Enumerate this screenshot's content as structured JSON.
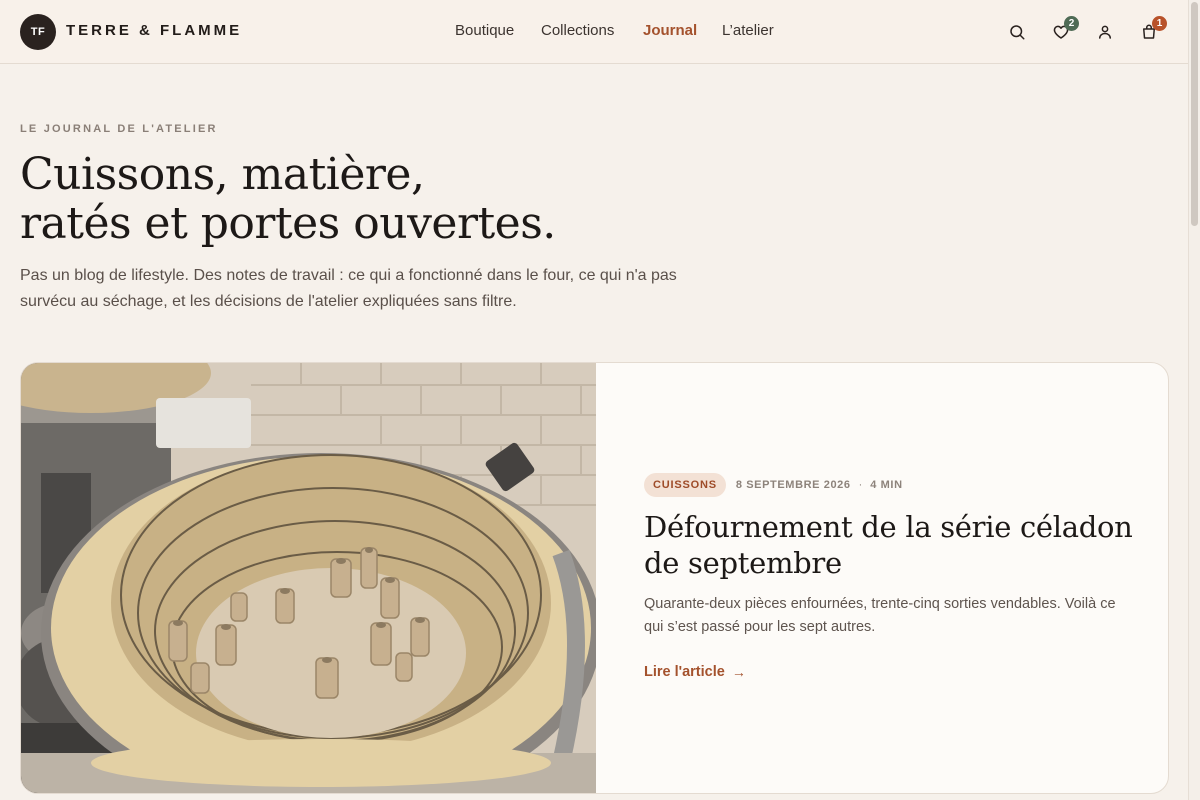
{
  "brand": {
    "monogram": "TF",
    "name": "TERRE & FLAMME"
  },
  "nav": {
    "items": [
      {
        "label": "Boutique"
      },
      {
        "label": "Collections"
      },
      {
        "label": "Journal"
      },
      {
        "label": "L’atelier"
      }
    ],
    "active": "Journal"
  },
  "header_actions": {
    "wishlist_count": "2",
    "cart_count": "1"
  },
  "hero": {
    "eyebrow": "LE JOURNAL DE L'ATELIER",
    "title_line1": "Cuissons, matière,",
    "title_line2": "ratés et portes ouvertes.",
    "lead": "Pas un blog de lifestyle. Des notes de travail : ce qui a fonctionné dans le four, ce qui n'a pas survécu au séchage, et les décisions de l'atelier expliquées sans filtre."
  },
  "featured": {
    "tag": "CUISSONS",
    "date": "8 SEPTEMBRE 2026",
    "read_time": "4 MIN",
    "title": "Défournement de la série céladon de septembre",
    "excerpt": "Quarante-deux pièces enfournées, trente-cinq sorties vendables. Voilà ce qui s’est passé pour les sept autres.",
    "link_label": "Lire l'article",
    "image_subject": "kiln-interior-photo"
  },
  "colors": {
    "background": "#f6f1eb",
    "accent": "#a4522d",
    "badge_green": "#4f6b55",
    "badge_orange": "#b8522a"
  }
}
